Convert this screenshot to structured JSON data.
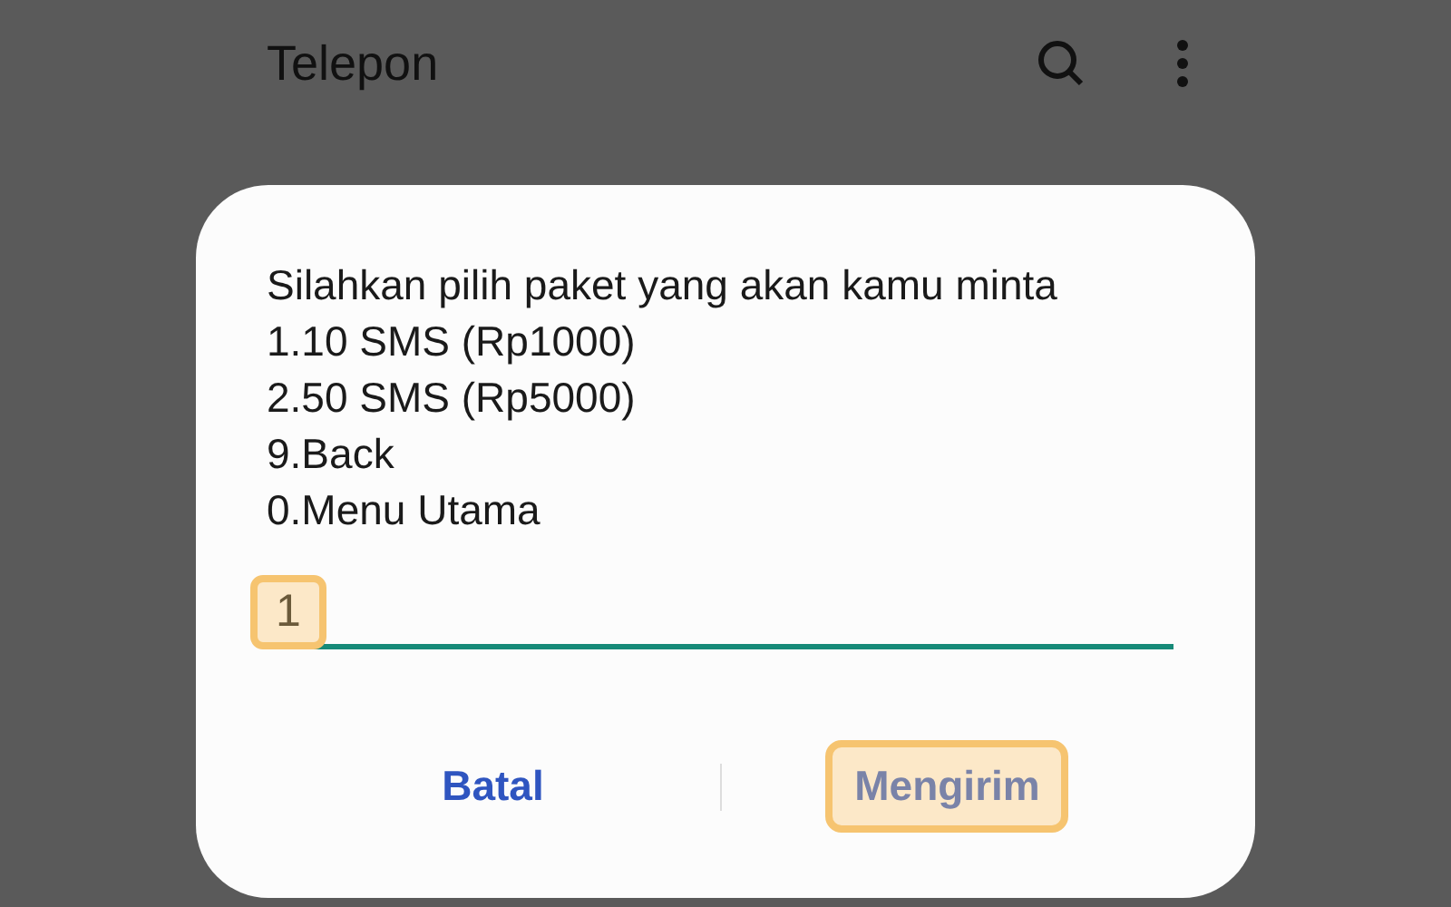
{
  "app_bar": {
    "title": "Telepon"
  },
  "dialog": {
    "message_lines": [
      "Silahkan pilih paket yang akan kamu minta",
      "1.10 SMS (Rp1000)",
      "2.50 SMS (Rp5000)",
      "9.Back",
      "0.Menu Utama"
    ],
    "input": {
      "value": "1",
      "highlighted": true
    },
    "buttons": [
      {
        "label": "Batal",
        "kind": "cancel",
        "highlighted": false
      },
      {
        "label": "Mengirim",
        "kind": "send",
        "highlighted": true
      }
    ]
  }
}
